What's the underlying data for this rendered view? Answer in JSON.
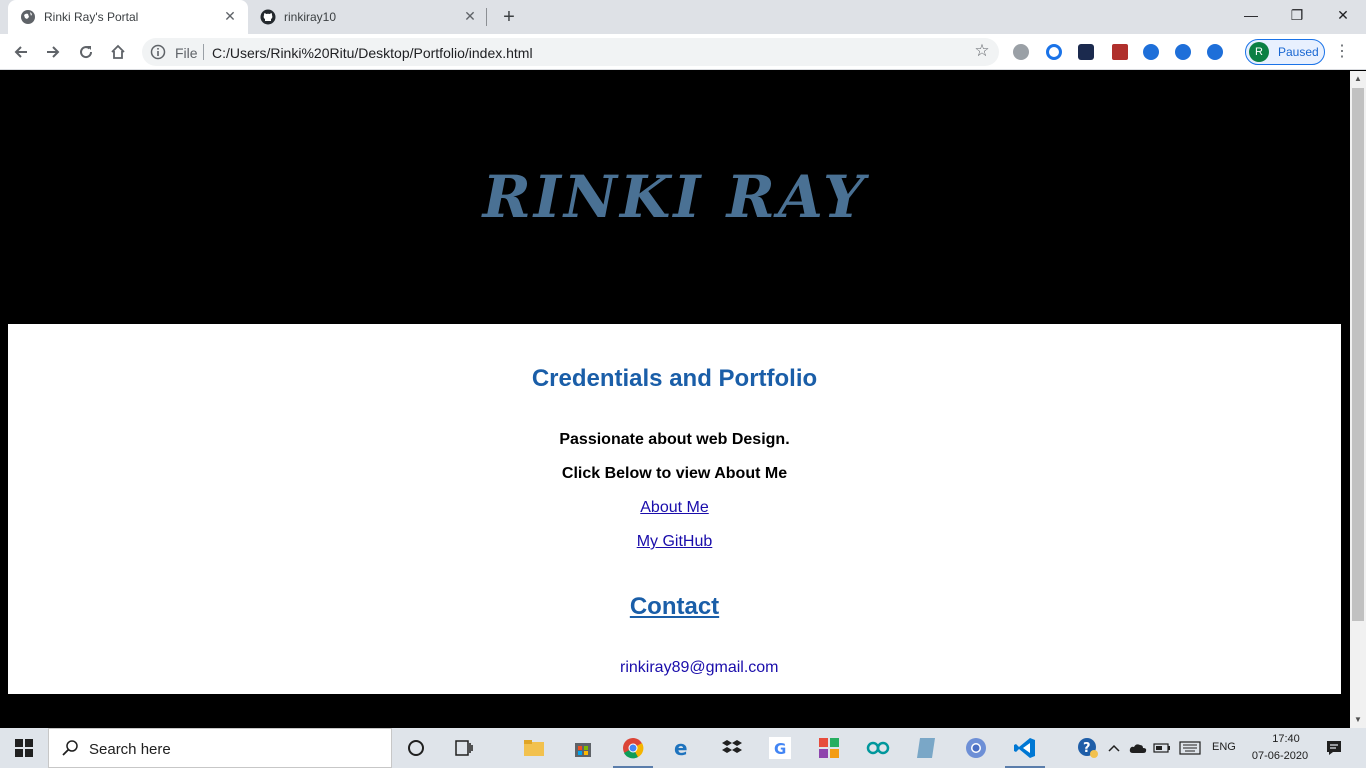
{
  "browser": {
    "tabs": [
      {
        "title": "Rinki Ray's Portal",
        "active": true
      },
      {
        "title": "rinkiray10",
        "active": false
      }
    ],
    "address": {
      "scheme_label": "File",
      "url": "C:/Users/Rinki%20Ritu/Desktop/Portfolio/index.html"
    },
    "profile": {
      "initial": "R",
      "status": "Paused"
    }
  },
  "page": {
    "hero_title": "RINKI RAY",
    "section_title": "Credentials and Portfolio",
    "tagline": "Passionate about web Design.",
    "prompt": "Click Below to view About Me",
    "about_link": "About Me",
    "github_link": "My GitHub",
    "contact_title": "Contact",
    "email": "rinkiray89@gmail.com"
  },
  "taskbar": {
    "search_placeholder": "Search here",
    "language": "ENG",
    "time": "17:40",
    "date": "07-06-2020"
  },
  "colors": {
    "hero_title": "#4a7194",
    "heading_blue": "#1a5ea8",
    "link": "#1a0dab"
  }
}
